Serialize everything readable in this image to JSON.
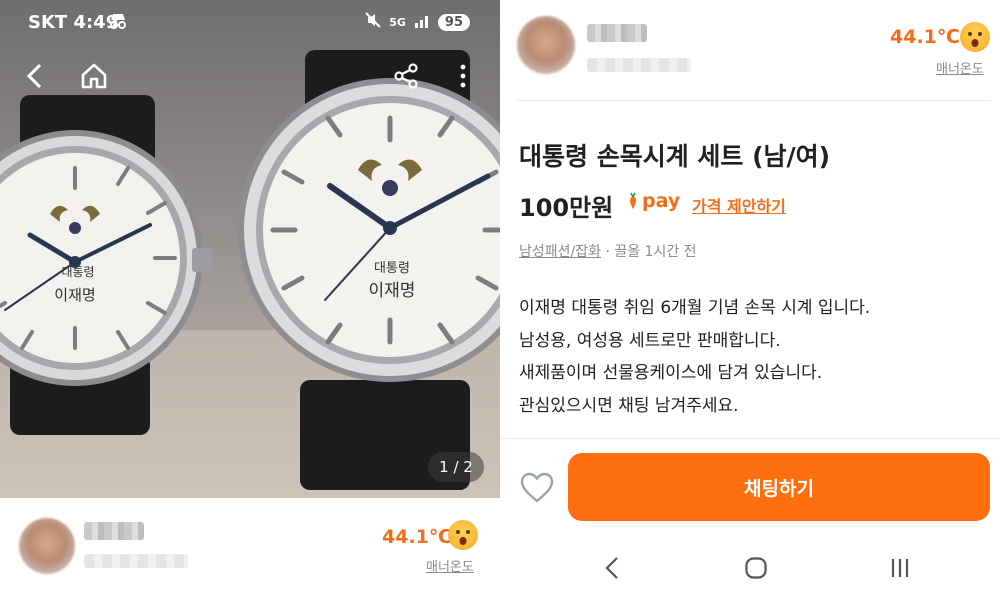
{
  "status_bar": {
    "carrier_time": "SKT 4:49",
    "network": "5G",
    "battery": "95"
  },
  "photo": {
    "page_indicator": "1 / 2",
    "watch_small_text_line1": "대통령",
    "watch_small_text_line2": "이재명",
    "watch_large_text_line1": "대통령",
    "watch_large_text_line2": "이재명"
  },
  "seller": {
    "temperature": "44.1℃",
    "manner_label": "매너온도"
  },
  "product": {
    "title": "대통령 손목시계 세트 (남/여)",
    "price": "100만원",
    "pay_label": "pay",
    "offer_link": "가격 제안하기",
    "category": "남성패션/잡화",
    "time_info": " · 끌올 1시간 전",
    "description": [
      "이재명 대통령 취임 6개월 기념 손목 시계 입니다.",
      "남성용, 여성용 세트로만 판매합니다.",
      "새제품이며 선물용케이스에 담겨 있습니다.",
      "관심있으시면 채팅 남겨주세요."
    ]
  },
  "actions": {
    "chat_button": "채팅하기"
  },
  "colors": {
    "accent": "#ff6f0f",
    "temperature": "#f26d1c",
    "muted": "#868b94"
  }
}
